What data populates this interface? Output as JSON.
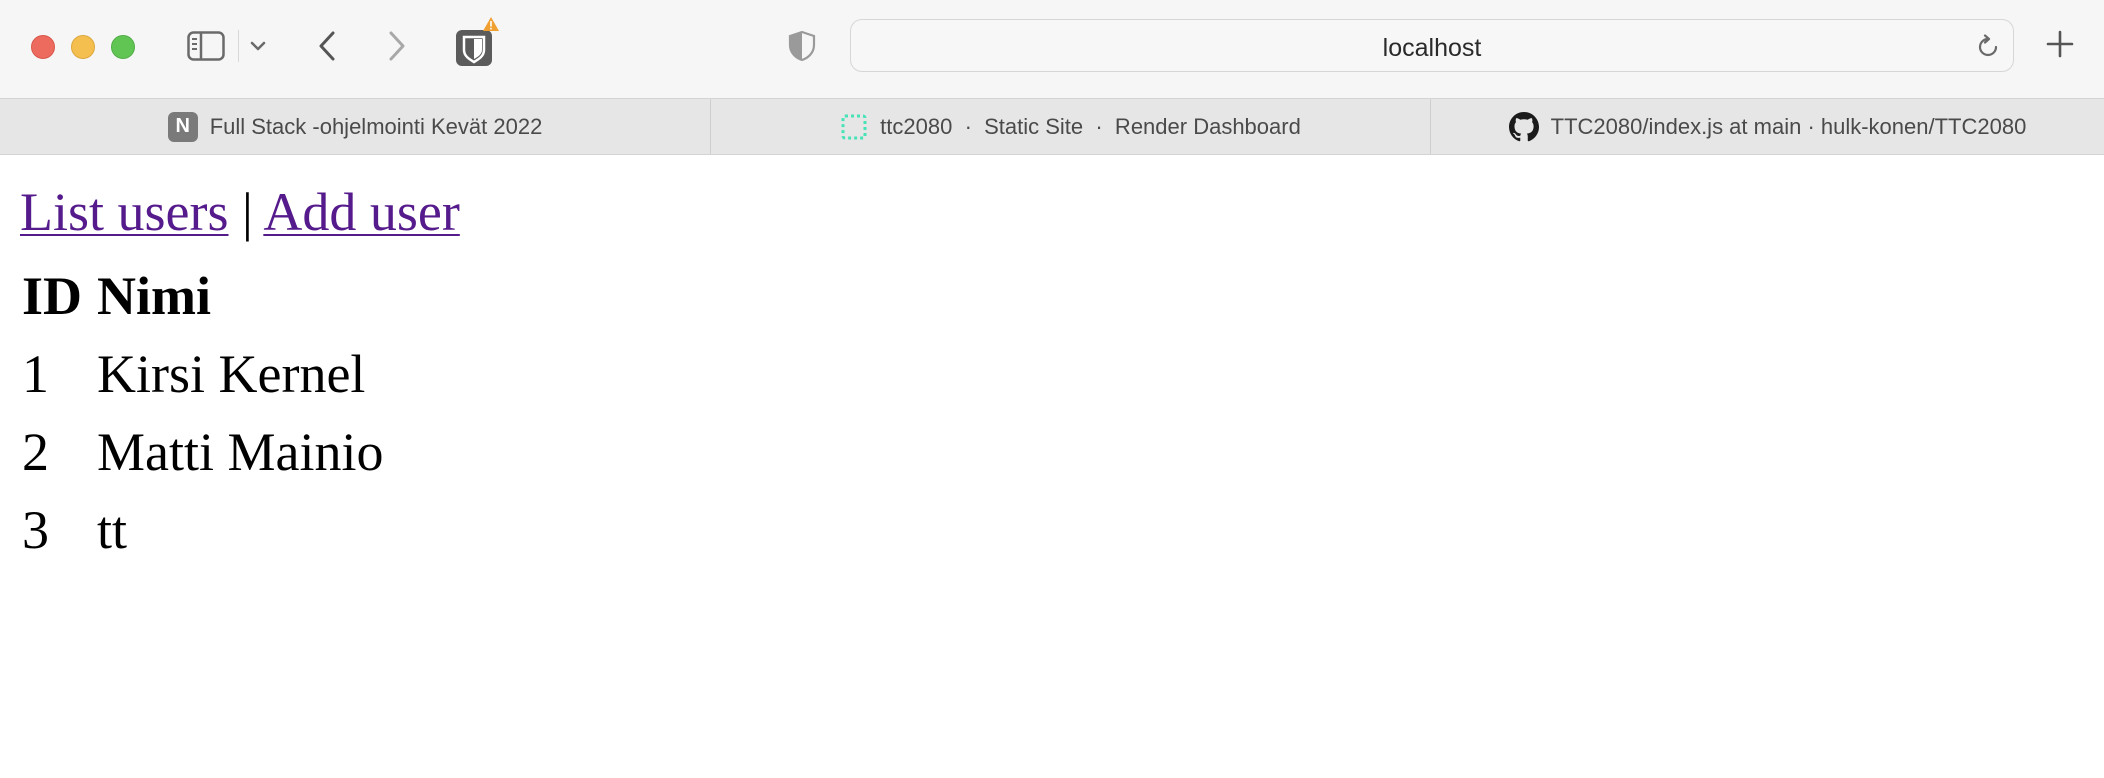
{
  "browser": {
    "address": "localhost",
    "tabs": [
      {
        "label": "Full Stack -ohjelmointi Kevät 2022",
        "favicon": "N"
      },
      {
        "label": "ttc2080  ·  Static Site  ·  Render Dashboard",
        "favicon": "render-icon"
      },
      {
        "label": "TTC2080/index.js at main · hulk-konen/TTC2080",
        "favicon": "github-icon"
      }
    ]
  },
  "page": {
    "nav": {
      "list_users": "List users",
      "separator": "|",
      "add_user": "Add user"
    },
    "table": {
      "headers": [
        "ID",
        "Nimi"
      ],
      "rows": [
        {
          "id": "1",
          "name": "Kirsi Kernel"
        },
        {
          "id": "2",
          "name": "Matti Mainio"
        },
        {
          "id": "3",
          "name": "tt"
        }
      ]
    }
  },
  "colors": {
    "link_visited": "#551a8b",
    "toolbar_bg": "#f6f6f6",
    "tabbar_bg": "#e6e6e6",
    "traffic_close": "#ed6a5e",
    "traffic_minimize": "#f5bf4f",
    "traffic_maximize": "#61c554",
    "extension_warning": "#f0a030",
    "render_favicon": "#46e3b7"
  }
}
